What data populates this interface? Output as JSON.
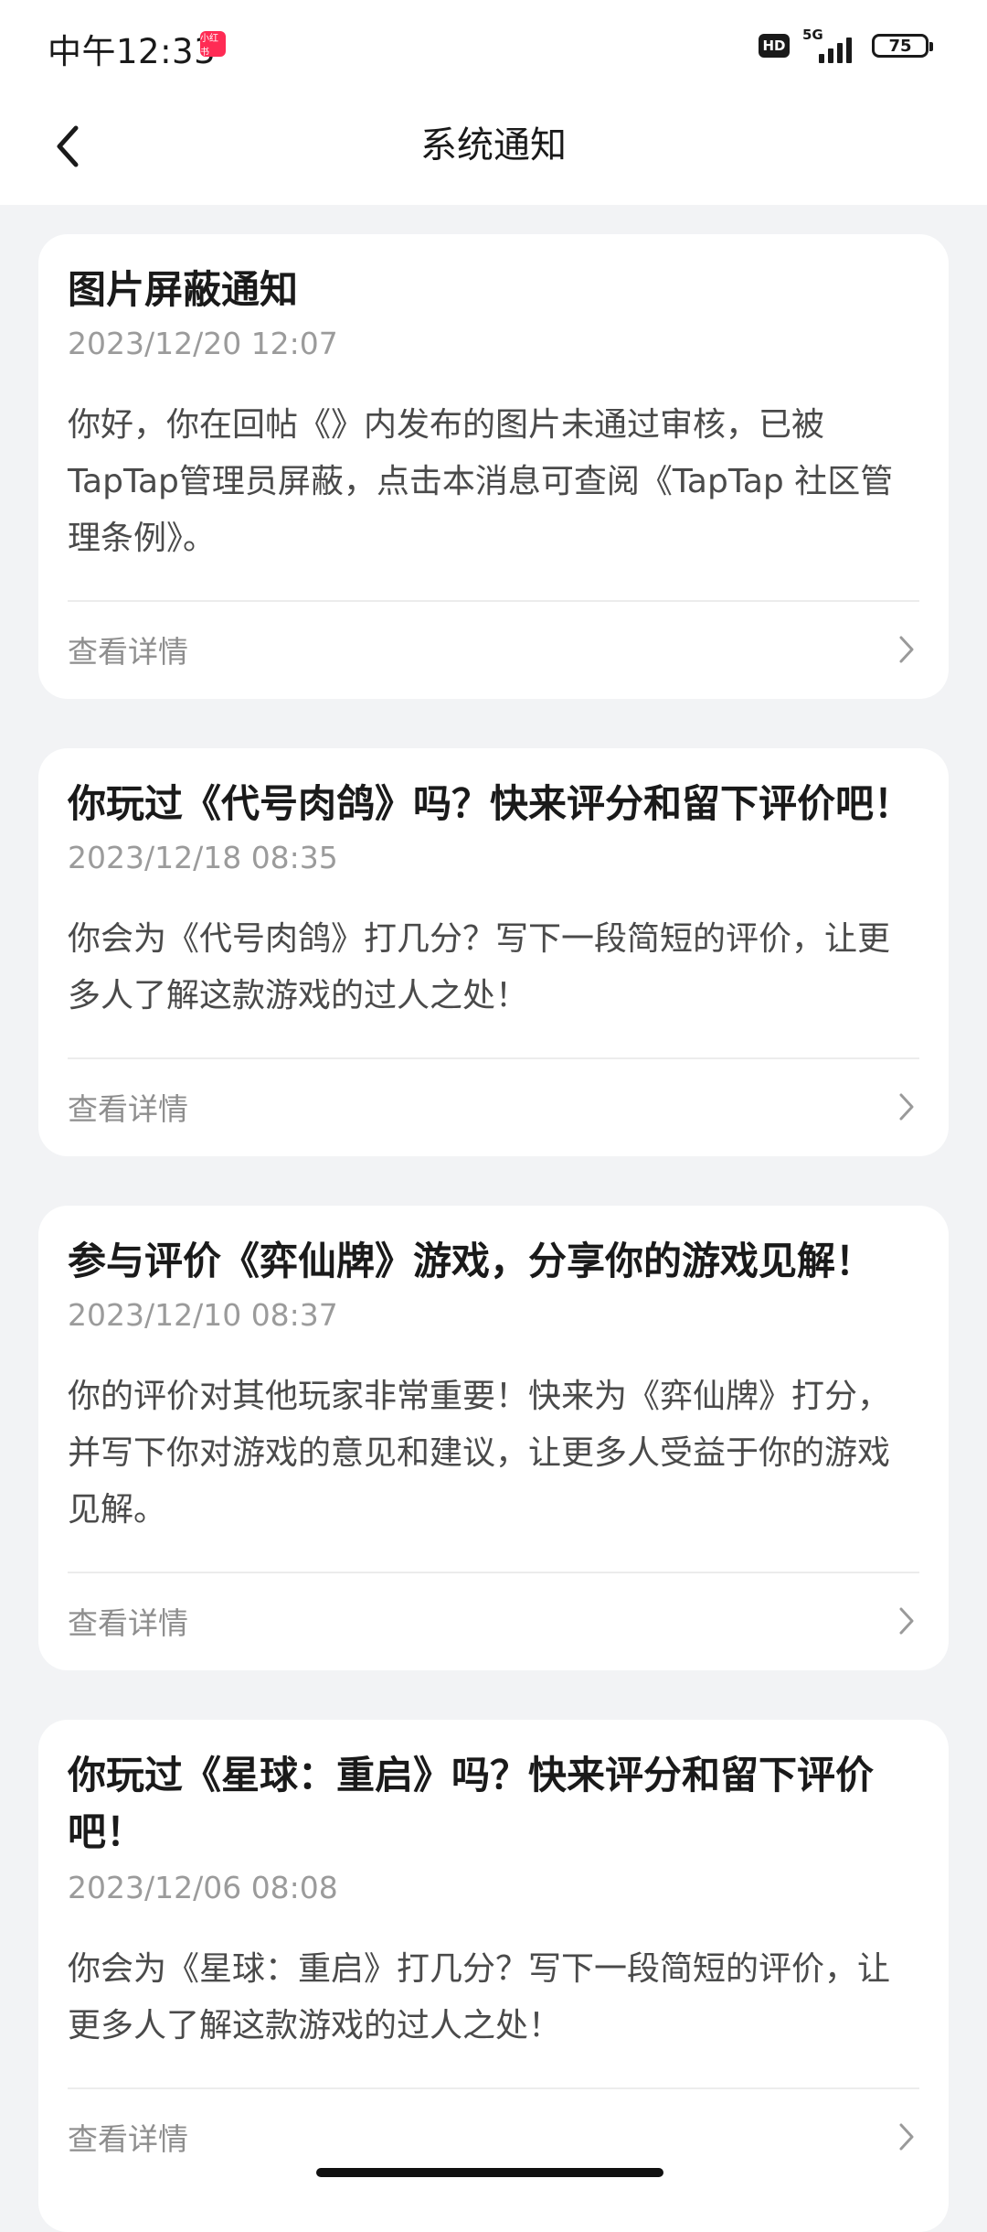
{
  "status_bar": {
    "time": "中午12:33",
    "app_badge": "小红书",
    "hd": "HD",
    "network": "5G",
    "battery": "75"
  },
  "nav": {
    "title": "系统通知"
  },
  "notifications": [
    {
      "title": "图片屏蔽通知",
      "date": "2023/12/20 12:07",
      "body": "你好，你在回帖《》内发布的图片未通过审核，已被TapTap管理员屏蔽，点击本消息可查阅《TapTap 社区管理条例》。",
      "detail_label": "查看详情"
    },
    {
      "title": "你玩过《代号肉鸽》吗？快来评分和留下评价吧！",
      "date": "2023/12/18 08:35",
      "body": "你会为《代号肉鸽》打几分？写下一段简短的评价，让更多人了解这款游戏的过人之处！",
      "detail_label": "查看详情"
    },
    {
      "title": "参与评价《弈仙牌》游戏，分享你的游戏见解！",
      "date": "2023/12/10 08:37",
      "body": "你的评价对其他玩家非常重要！快来为《弈仙牌》打分，并写下你对游戏的意见和建议，让更多人受益于你的游戏见解。",
      "detail_label": "查看详情"
    },
    {
      "title": "你玩过《星球：重启》吗？快来评分和留下评价吧！",
      "date": "2023/12/06 08:08",
      "body": "你会为《星球：重启》打几分？写下一段简短的评价，让更多人了解这款游戏的过人之处！",
      "detail_label": "查看详情"
    }
  ]
}
